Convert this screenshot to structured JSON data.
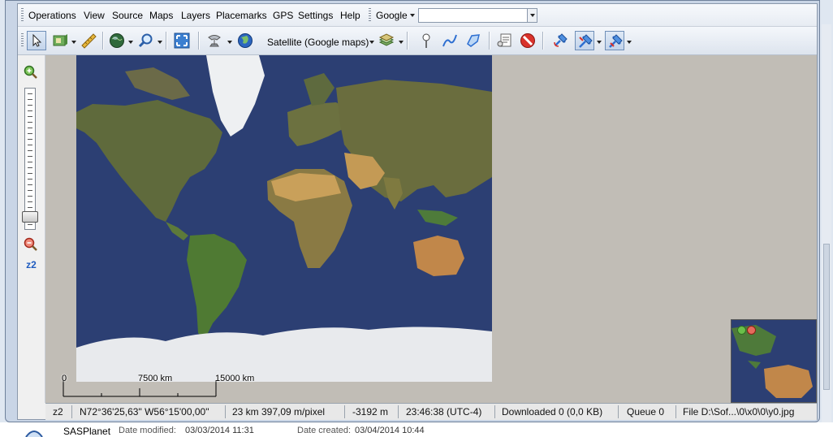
{
  "menu": {
    "operations": "Operations",
    "view": "View",
    "source": "Source",
    "maps": "Maps",
    "layers": "Layers",
    "placemarks": "Placemarks",
    "gps": "GPS",
    "settings": "Settings",
    "help": "Help"
  },
  "search": {
    "provider": "Google",
    "value": ""
  },
  "toolbar": {
    "map_source": "Satellite (Google maps)",
    "icons": [
      "cursor-icon",
      "layers-icon",
      "ruler-icon",
      "globe-icon",
      "magnifier-icon",
      "fullscreen-icon",
      "satellite-dish-icon",
      "globe-map-icon",
      "tiles-icon",
      "placemark-pin-icon",
      "path-icon",
      "polygon-icon",
      "placemark-list-icon",
      "delete-placemarks-icon",
      "gps-icon",
      "gps-track-icon",
      "gps-center-icon"
    ]
  },
  "zoom": {
    "level": "z2"
  },
  "scale": {
    "zero": "0",
    "mid": "7500 km",
    "end": "15000 km"
  },
  "status": {
    "zoom": "z2",
    "coords": "N72°36'25,63\" W56°15'00,00\"",
    "resolution": "23 km 397,09 m/pixel",
    "elevation": "-3192 m",
    "time": "23:46:38 (UTC-4)",
    "downloaded": "Downloaded 0 (0,0 KB)",
    "queue": "Queue 0",
    "file": "File D:\\Sof...\\0\\x0\\0\\y0.jpg"
  },
  "footer": {
    "app_name": "SASPlanet",
    "modified_label": "Date modified:",
    "modified_value": "03/03/2014 11:31",
    "created_label": "Date created:",
    "created_value": "03/04/2014 10:44"
  },
  "colors": {
    "ocean": "#2c3f73",
    "land": "#6a6a3c",
    "ice": "#e9ebee",
    "desert": "#c49a55",
    "accent": "#1e5bbf"
  }
}
